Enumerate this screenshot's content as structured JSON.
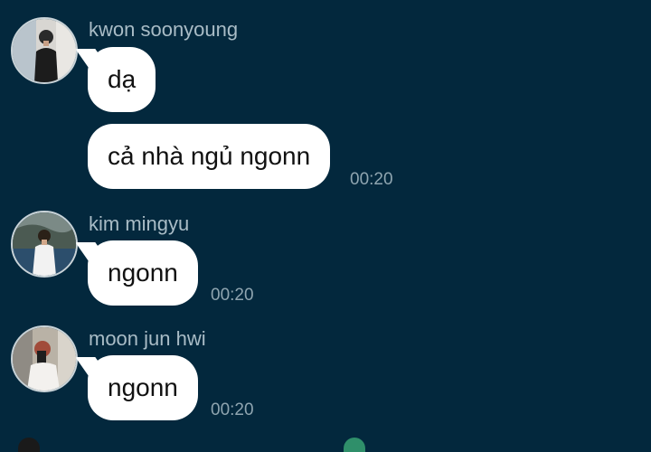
{
  "conversation": {
    "messages": [
      {
        "sender": "kwon soonyoung",
        "avatar_icon": "user-avatar-photo",
        "texts": [
          "dạ",
          "cả nhà ngủ ngonn"
        ],
        "time": "00:20"
      },
      {
        "sender": "kim mingyu",
        "avatar_icon": "user-avatar-photo",
        "texts": [
          "ngonn"
        ],
        "time": "00:20"
      },
      {
        "sender": "moon jun hwi",
        "avatar_icon": "user-avatar-photo",
        "texts": [
          "ngonn"
        ],
        "time": "00:20"
      }
    ]
  },
  "colors": {
    "background": "#03283d",
    "bubble": "#ffffff",
    "sender_name": "#a9bcc6",
    "timestamp": "#8fa5b0"
  }
}
